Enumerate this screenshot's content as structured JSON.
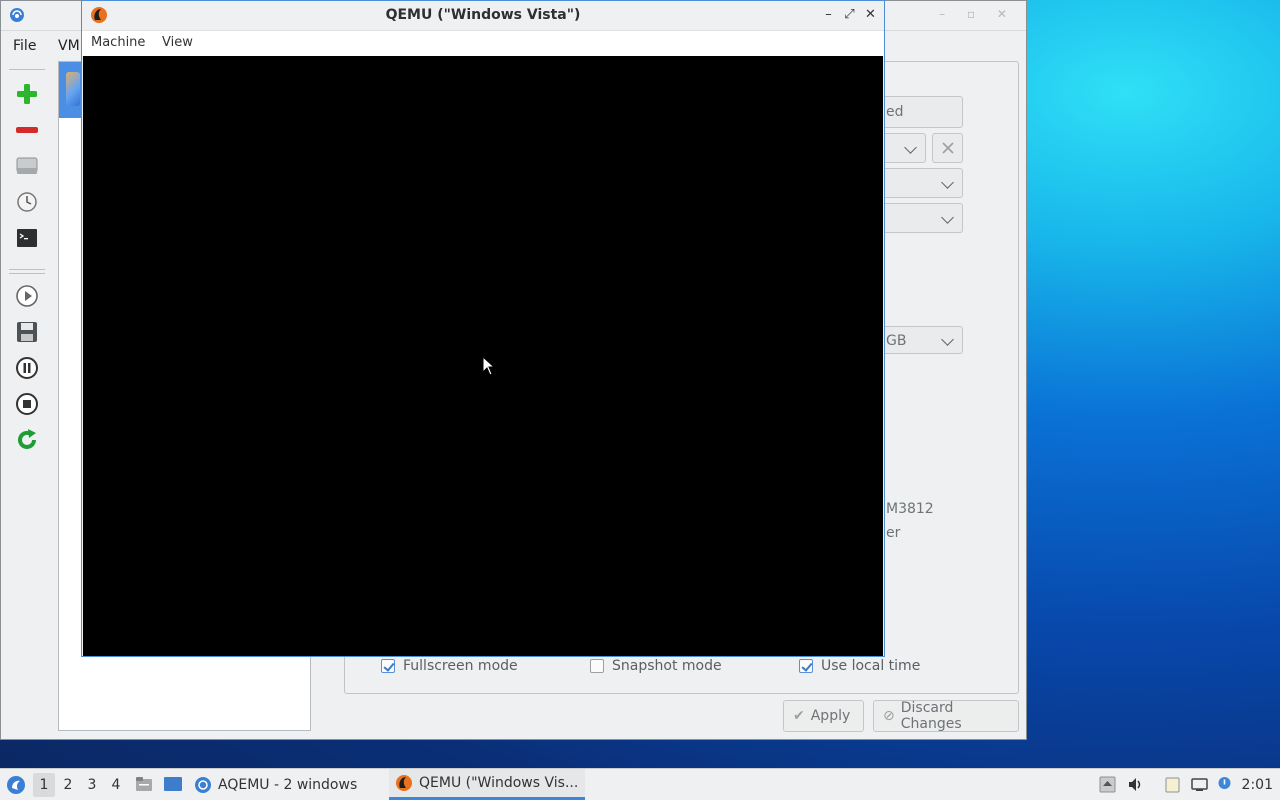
{
  "aqemu": {
    "menus": [
      "File",
      "VM"
    ],
    "partial_texts": {
      "state_field": "ed",
      "memory_field": "GB",
      "cpu_label": "M3812",
      "extra_label": "er"
    },
    "options": [
      {
        "label": "Fullscreen mode",
        "checked": true
      },
      {
        "label": "Snapshot mode",
        "checked": false
      },
      {
        "label": "Use local time",
        "checked": true
      }
    ],
    "buttons": {
      "apply": "Apply",
      "discard": "Discard Changes"
    }
  },
  "qemu": {
    "title": "QEMU (\"Windows Vista\")",
    "menus": [
      "Machine",
      "View"
    ]
  },
  "taskbar": {
    "workspaces": [
      "1",
      "2",
      "3",
      "4"
    ],
    "active_workspace": "1",
    "tasks": [
      {
        "label": "AQEMU - 2 windows",
        "active": false
      },
      {
        "label": "QEMU (\"Windows Vis...",
        "active": true
      }
    ],
    "clock": "2:01"
  },
  "colors": {
    "accent": "#3e87d8",
    "vm_screen": "#000000"
  }
}
